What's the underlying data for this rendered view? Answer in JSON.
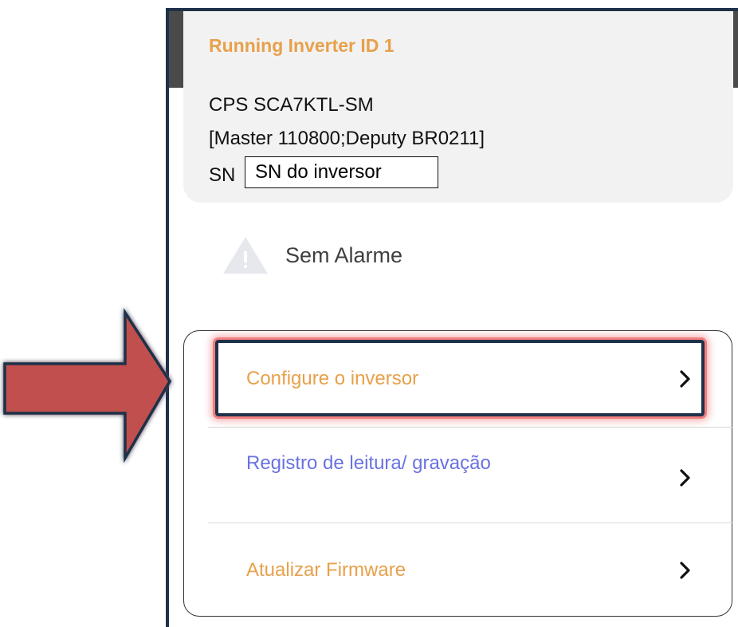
{
  "inverter_card": {
    "title": "Running Inverter ID 1",
    "model": "CPS SCA7KTL-SM",
    "version": "[Master 110800;Deputy BR0211]",
    "sn_label": "SN",
    "sn_callout": "SN do inversor"
  },
  "alarm": {
    "icon": "warning-triangle-icon",
    "text": "Sem Alarme"
  },
  "menu": {
    "items": [
      {
        "label": "Configure o inversor",
        "icon": "chevron-right-icon",
        "color": "#e8a04a",
        "highlighted": true
      },
      {
        "label": "Registro de leitura/ gravação",
        "icon": "chevron-right-icon",
        "color": "#6a72df",
        "highlighted": false
      },
      {
        "label": "Atualizar Firmware",
        "icon": "chevron-right-icon",
        "color": "#e8a04a",
        "highlighted": false
      }
    ]
  },
  "annotations": {
    "arrow_icon": "red-arrow-icon",
    "arrow_color": "#c0504d",
    "highlight_color": "#1f3049"
  },
  "colors": {
    "accent_orange": "#e8a04a",
    "accent_blue": "#6a72df",
    "card_background": "#f2f2f2"
  }
}
